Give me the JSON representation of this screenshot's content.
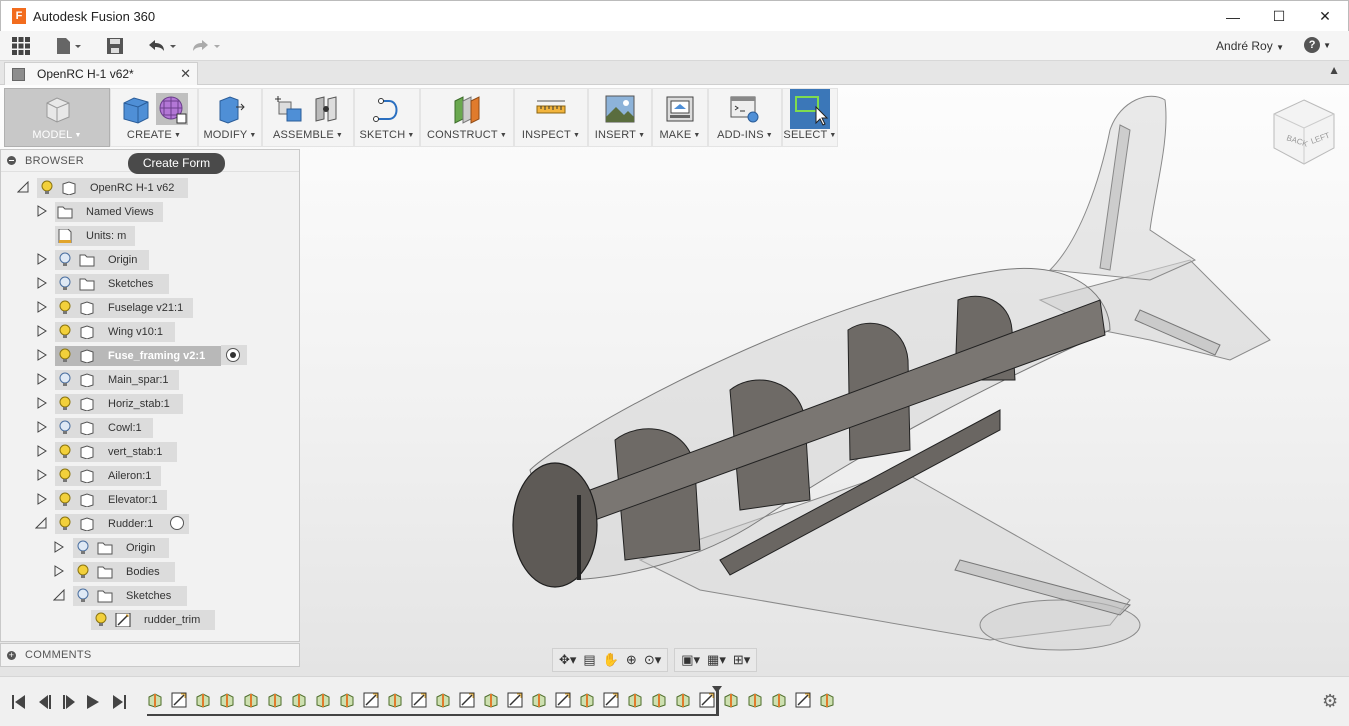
{
  "window": {
    "title": "Autodesk Fusion 360",
    "logo_letter": "F",
    "controls": [
      "—",
      "☐",
      "✕"
    ]
  },
  "qat": {
    "user": "André Roy",
    "help": "?"
  },
  "document_tab": {
    "name": "OpenRC H-1 v62*",
    "close": "✕"
  },
  "toolbar": {
    "groups": [
      {
        "label": "MODEL",
        "caret": "▼"
      },
      {
        "label": "CREATE",
        "caret": "▼"
      },
      {
        "label": "MODIFY",
        "caret": "▼"
      },
      {
        "label": "ASSEMBLE",
        "caret": "▼"
      },
      {
        "label": "SKETCH",
        "caret": "▼"
      },
      {
        "label": "CONSTRUCT",
        "caret": "▼"
      },
      {
        "label": "INSPECT",
        "caret": "▼"
      },
      {
        "label": "INSERT",
        "caret": "▼"
      },
      {
        "label": "MAKE",
        "caret": "▼"
      },
      {
        "label": "ADD-INS",
        "caret": "▼"
      },
      {
        "label": "SELECT",
        "caret": "▼"
      }
    ]
  },
  "tooltip": "Create Form",
  "browser": {
    "title": "BROWSER",
    "items": [
      {
        "label": "OpenRC H-1 v62"
      },
      {
        "label": "Named Views"
      },
      {
        "label": "Units: m"
      },
      {
        "label": "Origin"
      },
      {
        "label": "Sketches"
      },
      {
        "label": "Fuselage v21:1"
      },
      {
        "label": "Wing v10:1"
      },
      {
        "label": "Fuse_framing v2:1"
      },
      {
        "label": "Main_spar:1"
      },
      {
        "label": "Horiz_stab:1"
      },
      {
        "label": "Cowl:1"
      },
      {
        "label": "vert_stab:1"
      },
      {
        "label": "Aileron:1"
      },
      {
        "label": "Elevator:1"
      },
      {
        "label": "Rudder:1"
      },
      {
        "label": "Origin"
      },
      {
        "label": "Bodies"
      },
      {
        "label": "Sketches"
      },
      {
        "label": "rudder_trim"
      }
    ]
  },
  "comments": {
    "title": "COMMENTS"
  },
  "viewcube": {
    "faces": [
      "BACK",
      "LEFT"
    ]
  }
}
